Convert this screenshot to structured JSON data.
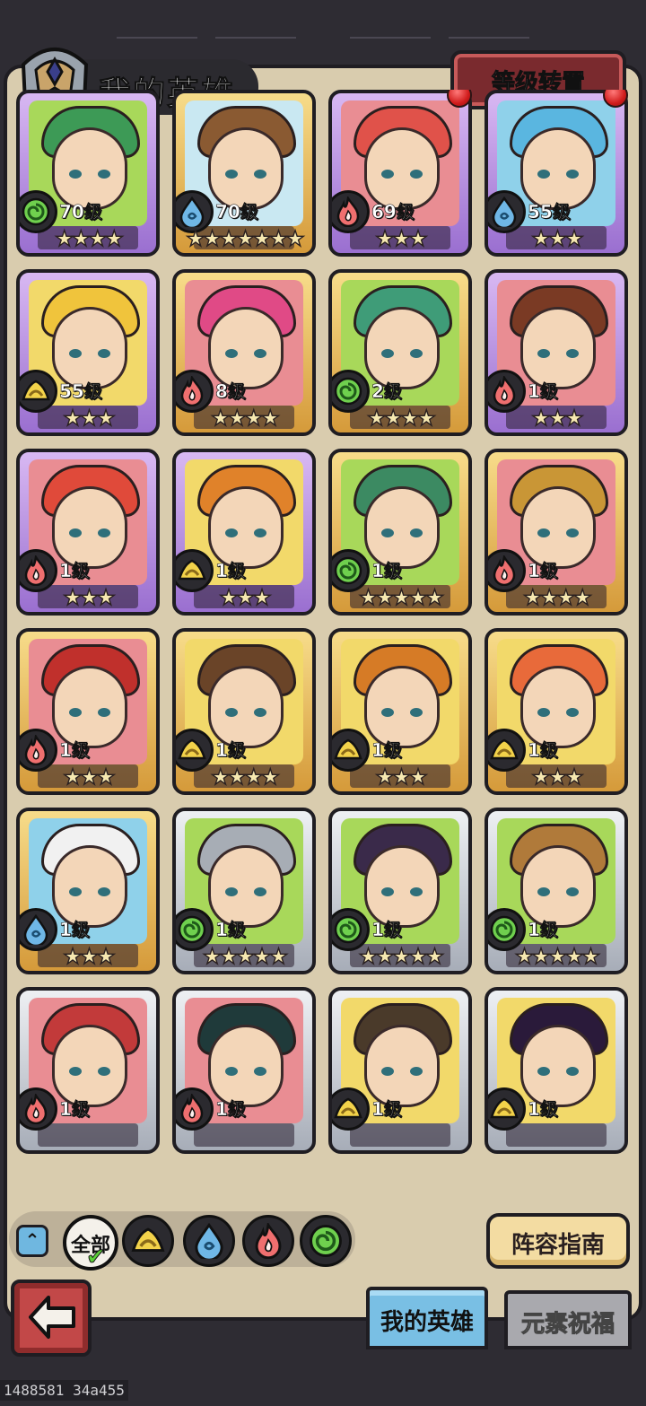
{
  "header": {
    "title": "我的英雄",
    "reset_button": "等级转置"
  },
  "heroes": [
    {
      "level": "70级",
      "stars": "★★★★",
      "element": "wind",
      "frame": "purple",
      "bg": "green",
      "hair": "#3d9a56",
      "badge": false
    },
    {
      "level": "70级",
      "stars": "★★★★★★★",
      "element": "water",
      "frame": "gold",
      "bg": "pale",
      "hair": "#8a5a32",
      "badge": false
    },
    {
      "level": "69级",
      "stars": "★★★",
      "element": "fire",
      "frame": "purple",
      "bg": "pink",
      "hair": "#e0524a",
      "badge": true
    },
    {
      "level": "55级",
      "stars": "★★★",
      "element": "water",
      "frame": "purple",
      "bg": "blue",
      "hair": "#5ab6e0",
      "badge": true
    },
    {
      "level": "55级",
      "stars": "★★★",
      "element": "earth",
      "frame": "purple",
      "bg": "yellow",
      "hair": "#f0c43c",
      "badge": false
    },
    {
      "level": "8级",
      "stars": "★★★★",
      "element": "fire",
      "frame": "gold",
      "bg": "pink",
      "hair": "#e04a86",
      "badge": false
    },
    {
      "level": "2级",
      "stars": "★★★★",
      "element": "wind",
      "frame": "gold",
      "bg": "green",
      "hair": "#3f9c78",
      "badge": false
    },
    {
      "level": "1级",
      "stars": "★★★",
      "element": "fire",
      "frame": "purple",
      "bg": "pink",
      "hair": "#7a3a24",
      "badge": false
    },
    {
      "level": "1级",
      "stars": "★★★",
      "element": "fire",
      "frame": "purple",
      "bg": "pink",
      "hair": "#e04a3a",
      "badge": false
    },
    {
      "level": "1级",
      "stars": "★★★",
      "element": "earth",
      "frame": "purple",
      "bg": "yellow",
      "hair": "#e0822a",
      "badge": false
    },
    {
      "level": "1级",
      "stars": "★★★★★",
      "element": "wind",
      "frame": "gold",
      "bg": "green",
      "hair": "#3c8a62",
      "badge": false
    },
    {
      "level": "1级",
      "stars": "★★★★",
      "element": "fire",
      "frame": "gold",
      "bg": "pink",
      "hair": "#c99636",
      "badge": false
    },
    {
      "level": "1级",
      "stars": "★★★",
      "element": "fire",
      "frame": "gold",
      "bg": "pink",
      "hair": "#c0302c",
      "badge": false
    },
    {
      "level": "1级",
      "stars": "★★★★",
      "element": "earth",
      "frame": "gold",
      "bg": "yellow",
      "hair": "#6a4428",
      "badge": false
    },
    {
      "level": "1级",
      "stars": "★★★",
      "element": "earth",
      "frame": "gold",
      "bg": "yellow",
      "hair": "#d67b26",
      "badge": false
    },
    {
      "level": "1级",
      "stars": "★★★",
      "element": "earth",
      "frame": "gold",
      "bg": "yellow",
      "hair": "#e86a3a",
      "badge": false
    },
    {
      "level": "1级",
      "stars": "★★★",
      "element": "water",
      "frame": "gold",
      "bg": "blue",
      "hair": "#f1f1f1",
      "badge": false
    },
    {
      "level": "1级",
      "stars": "★★★★★",
      "element": "wind",
      "frame": "silver",
      "bg": "green",
      "hair": "#a7adb5",
      "badge": false
    },
    {
      "level": "1级",
      "stars": "★★★★★",
      "element": "wind",
      "frame": "silver",
      "bg": "green",
      "hair": "#3a2a4a",
      "badge": false
    },
    {
      "level": "1级",
      "stars": "★★★★★",
      "element": "wind",
      "frame": "silver",
      "bg": "green",
      "hair": "#b07a3a",
      "badge": false
    },
    {
      "level": "1级",
      "stars": "",
      "element": "fire",
      "frame": "silver",
      "bg": "pink",
      "hair": "#c23a3a",
      "badge": false
    },
    {
      "level": "1级",
      "stars": "",
      "element": "fire",
      "frame": "silver",
      "bg": "pink",
      "hair": "#1f3a3a",
      "badge": false
    },
    {
      "level": "1级",
      "stars": "",
      "element": "earth",
      "frame": "silver",
      "bg": "yellow",
      "hair": "#4a3a2a",
      "badge": false
    },
    {
      "level": "1级",
      "stars": "",
      "element": "earth",
      "frame": "silver",
      "bg": "yellow",
      "hair": "#2a1a3a",
      "badge": false
    }
  ],
  "filters": {
    "all_label": "全部",
    "elements": [
      "earth",
      "water",
      "fire",
      "wind"
    ]
  },
  "guide_button": "阵容指南",
  "tabs": {
    "my_heroes": "我的英雄",
    "element_blessing": "元素祝福"
  },
  "footer_text": "1488581 34a455",
  "colors": {
    "earth": "#f2d24a",
    "water": "#6fb7e6",
    "fire": "#ef6f6f",
    "wind": "#6fd04e"
  }
}
